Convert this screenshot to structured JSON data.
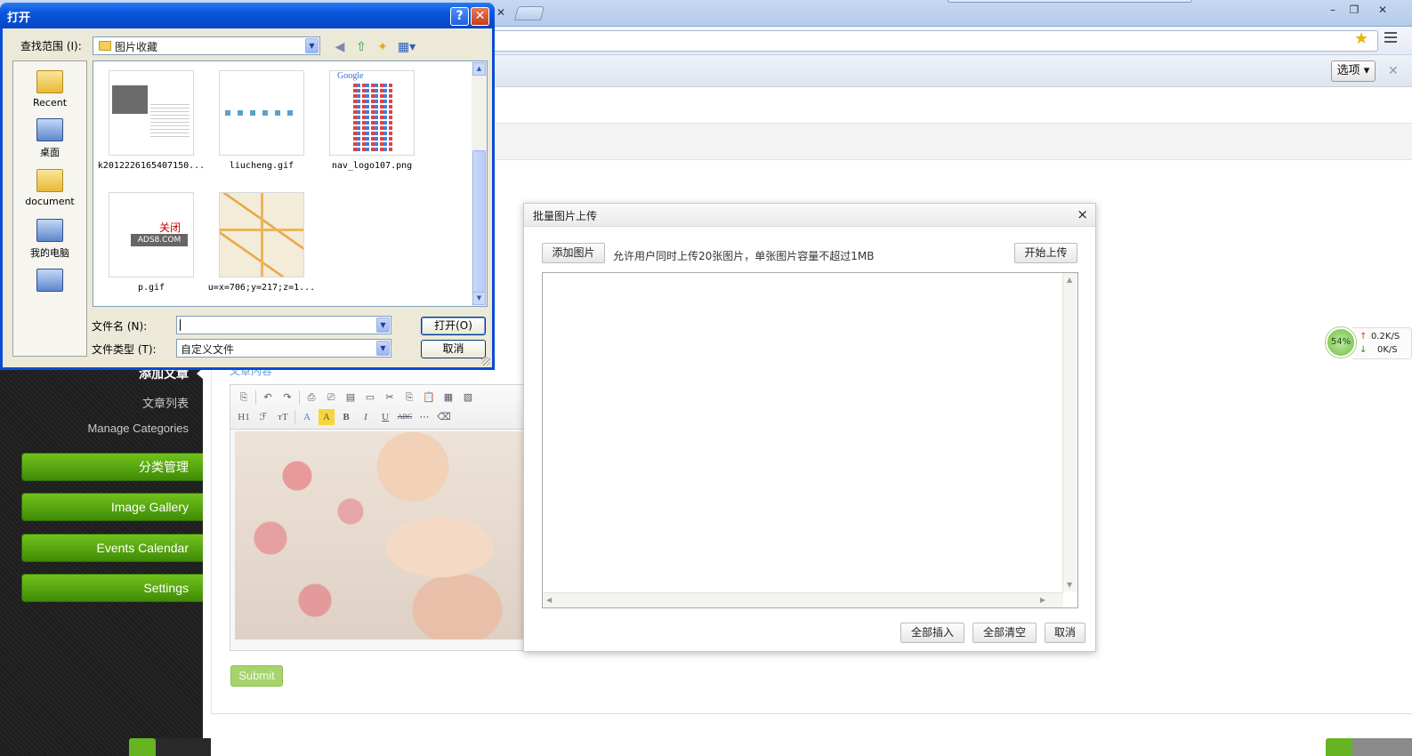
{
  "browser": {
    "tab_close": "✕",
    "options_label": "选项",
    "window_controls": [
      "–",
      "❐",
      "✕"
    ]
  },
  "sidebar": {
    "active_item": "添加文章",
    "links": [
      "文章列表",
      "Manage Categories"
    ],
    "buttons": [
      "分类管理",
      "Image Gallery",
      "Events Calendar",
      "Settings"
    ]
  },
  "editor": {
    "content_label": "文章内容",
    "toolbar_row1": [
      "⎘",
      "↶",
      "↷",
      "⎙",
      "⎚",
      "▤",
      "▭",
      "✂",
      "⎘",
      "📋",
      "▦",
      "▧"
    ],
    "toolbar_row2": [
      "H1",
      "ℱ",
      "тT",
      "A",
      "A",
      "B",
      "I",
      "U",
      "ABC",
      "⋯",
      "⌫"
    ],
    "submit_label": "Submit"
  },
  "upload_dialog": {
    "title": "批量图片上传",
    "close": "×",
    "add_button": "添加图片",
    "note": "允许用户同时上传20张图片，单张图片容量不超过1MB",
    "start_button": "开始上传",
    "insert_all": "全部插入",
    "clear_all": "全部清空",
    "cancel": "取消"
  },
  "network_widget": {
    "percent": "54%",
    "up": "0.2K/S",
    "down": "0K/S"
  },
  "file_dialog": {
    "title": "打开",
    "help": "?",
    "close": "✕",
    "look_in_label": "查找范围 (I):",
    "look_in_value": "图片收藏",
    "places": [
      "Recent",
      "桌面",
      "document",
      "我的电脑",
      ""
    ],
    "files": [
      {
        "name": "k2012226165407150..."
      },
      {
        "name": "liucheng.gif"
      },
      {
        "name": "nav_logo107.png"
      },
      {
        "name": "p.gif"
      },
      {
        "name": "u=x=706;y=217;z=1..."
      }
    ],
    "thumb_texts": {
      "p_close": "关闭",
      "p_ads": "ADS8.COM",
      "nav_google": "Google"
    },
    "filename_label": "文件名 (N):",
    "filename_value": "",
    "filetype_label": "文件类型 (T):",
    "filetype_value": "自定义文件",
    "open_button": "打开(O)",
    "cancel_button": "取消"
  }
}
